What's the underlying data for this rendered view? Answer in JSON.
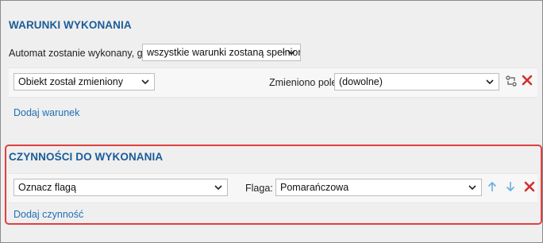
{
  "conditions": {
    "title": "WARUNKI WYKONANIA",
    "intro_label": "Automat zostanie wykonany, gdy",
    "mode_select": "wszystkie warunki zostaną spełnione",
    "row": {
      "event_select": "Obiekt został zmieniony",
      "field_label": "Zmieniono pole:",
      "field_select": "(dowolne)"
    },
    "add_link": "Dodaj warunek"
  },
  "actions": {
    "title": "CZYNNOŚCI DO WYKONANIA",
    "row": {
      "action_select": "Oznacz flagą",
      "flag_label": "Flaga:",
      "flag_select": "Pomarańczowa"
    },
    "add_link": "Dodaj czynność"
  },
  "icons": {
    "swap": "swap-icon",
    "delete": "delete-x-icon",
    "up": "arrow-up-icon",
    "down": "arrow-down-icon",
    "chevron": "chevron-down-icon"
  },
  "colors": {
    "heading": "#1a5c99",
    "link": "#1f6fb5",
    "delete": "#d32f2f",
    "arrows": "#6aaee0",
    "highlight_border": "#e04040"
  }
}
